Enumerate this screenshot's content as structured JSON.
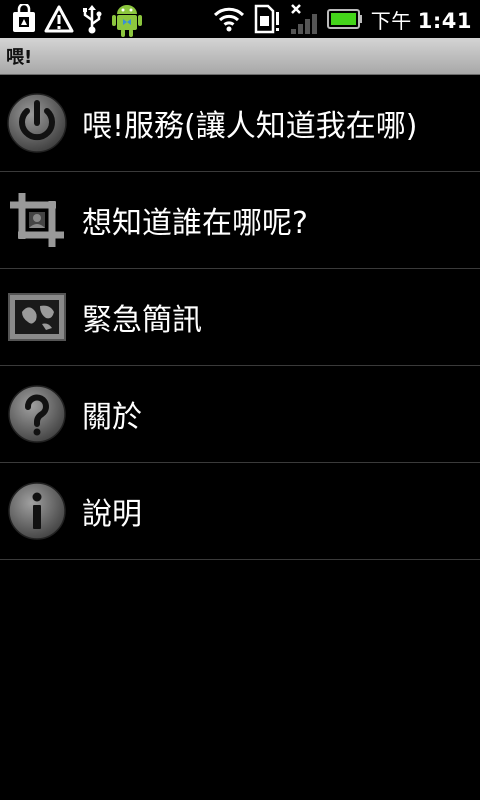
{
  "status_bar": {
    "time": "1:41",
    "ampm": "下午",
    "icons": [
      "bag-icon",
      "warning-icon",
      "usb-icon",
      "android-icon",
      "wifi-icon",
      "sim-icon",
      "signal-icon",
      "battery-icon"
    ]
  },
  "title_bar": {
    "title": "喂!"
  },
  "menu": {
    "items": [
      {
        "label": "喂!服務(讓人知道我在哪)",
        "icon": "power-icon"
      },
      {
        "label": "想知道誰在哪呢?",
        "icon": "crop-icon"
      },
      {
        "label": "緊急簡訊",
        "icon": "picture-icon"
      },
      {
        "label": "關於",
        "icon": "help-icon"
      },
      {
        "label": "說明",
        "icon": "info-icon"
      }
    ]
  },
  "colors": {
    "background": "#000000",
    "title_bar": "#bdbdbd",
    "battery": "#44d41a",
    "text": "#ffffff"
  }
}
